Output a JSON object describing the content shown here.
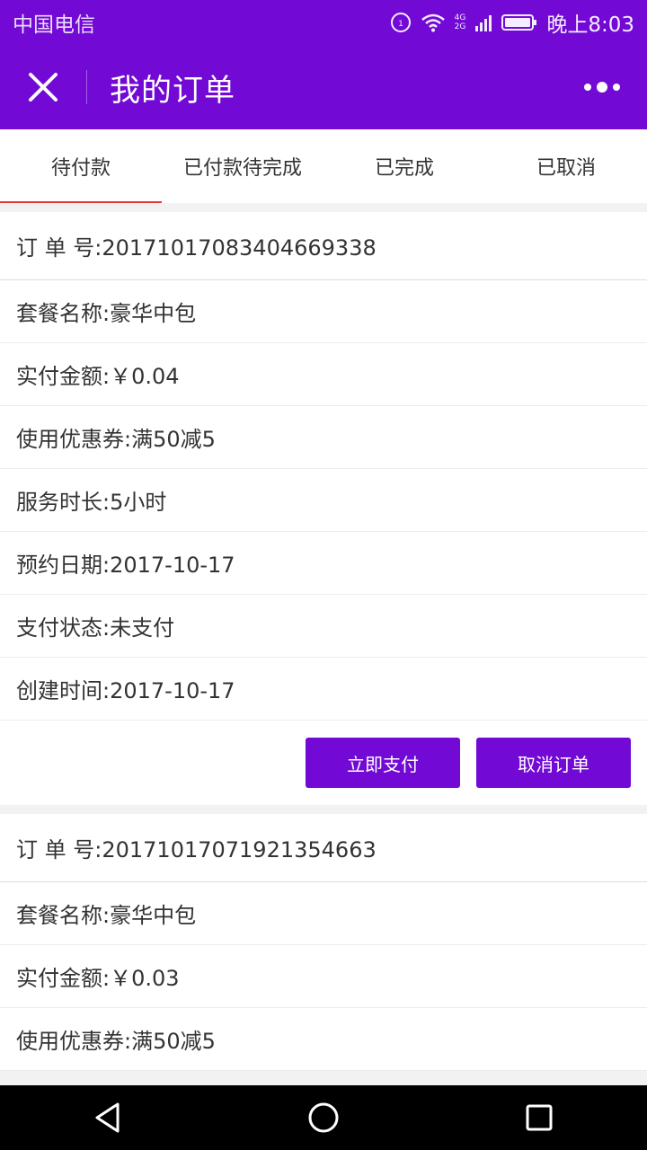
{
  "status_bar": {
    "carrier": "中国电信",
    "time": "晚上8:03",
    "network_label_top": "4G",
    "network_label_bottom": "2G"
  },
  "header": {
    "title": "我的订单",
    "close_icon": "close-icon",
    "more_icon": "more-icon",
    "background": "#7209d4"
  },
  "tabs": [
    {
      "label": "待付款",
      "active": true
    },
    {
      "label": "已付款待完成",
      "active": false
    },
    {
      "label": "已完成",
      "active": false
    },
    {
      "label": "已取消",
      "active": false
    }
  ],
  "orders": [
    {
      "rows": [
        "订 单 号:20171017083404669338",
        "套餐名称:豪华中包",
        "实付金额:￥0.04",
        "使用优惠券:满50减5",
        "服务时长:5小时",
        "预约日期:2017-10-17",
        "支付状态:未支付",
        "创建时间:2017-10-17"
      ],
      "pay_label": "立即支付",
      "cancel_label": "取消订单"
    },
    {
      "rows": [
        "订 单 号:20171017071921354663",
        "套餐名称:豪华中包",
        "实付金额:￥0.03",
        "使用优惠券:满50减5"
      ]
    }
  ],
  "colors": {
    "accent": "#7209d4",
    "active_tab_indicator": "#e53935"
  }
}
